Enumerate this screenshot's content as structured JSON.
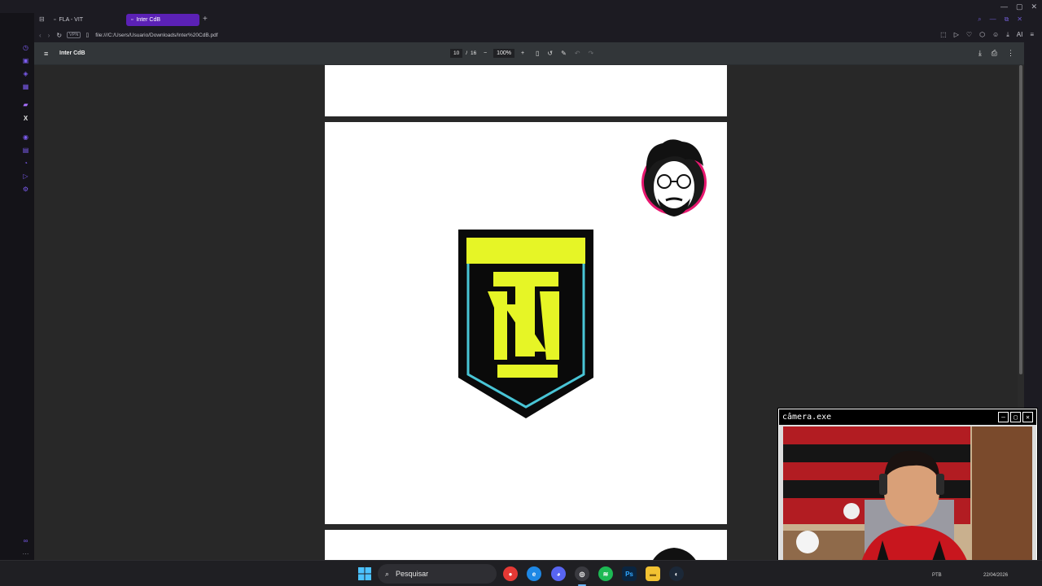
{
  "browser": {
    "tabs": [
      {
        "label": "FLA - VIT",
        "active": false
      },
      {
        "label": "Inter CdB",
        "active": true
      }
    ],
    "url": "file:///C:/Users/Usuario/Downloads/Inter%20CdB.pdf",
    "vpn_label": "VPN",
    "accent": "#5b21b6",
    "ai_label": "AI"
  },
  "pdf": {
    "title": "Inter CdB",
    "current_page": "10",
    "page_separator": "/",
    "total_pages": "16",
    "zoom": "100%"
  },
  "webcam": {
    "title": "câmera.exe"
  },
  "taskbar": {
    "search_placeholder": "Pesquisar",
    "lang": "PTB",
    "date": "22/04/2026"
  },
  "colors": {
    "crest_lime": "#e6f526",
    "crest_cyan": "#49c5d6",
    "crest_black": "#0a0a0a",
    "pdf_toolbar": "#323639",
    "viewer_bg": "#282828"
  }
}
